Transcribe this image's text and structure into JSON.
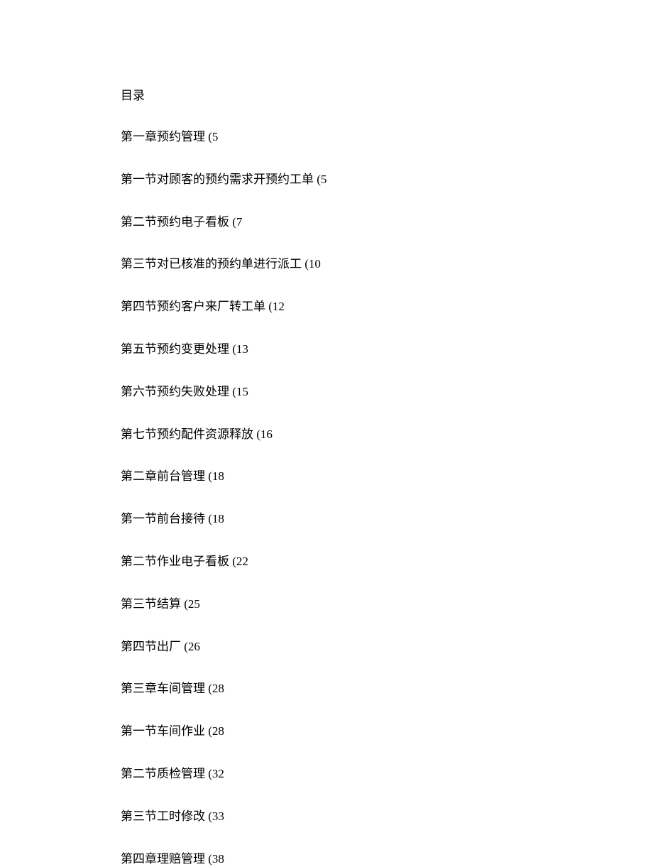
{
  "title": "目录",
  "entries": [
    {
      "label": "第一章预约管理",
      "page": "5"
    },
    {
      "label": "第一节对顾客的预约需求开预约工单",
      "page": "5"
    },
    {
      "label": "第二节预约电子看板",
      "page": "7"
    },
    {
      "label": "第三节对已核准的预约单进行派工",
      "page": "10"
    },
    {
      "label": "第四节预约客户来厂转工单",
      "page": "12"
    },
    {
      "label": "第五节预约变更处理",
      "page": "13"
    },
    {
      "label": "第六节预约失败处理",
      "page": "15"
    },
    {
      "label": "第七节预约配件资源释放",
      "page": "16"
    },
    {
      "label": "第二章前台管理",
      "page": "18"
    },
    {
      "label": "第一节前台接待",
      "page": "18"
    },
    {
      "label": "第二节作业电子看板",
      "page": "22"
    },
    {
      "label": "第三节结算",
      "page": "25"
    },
    {
      "label": "第四节出厂",
      "page": "26"
    },
    {
      "label": "第三章车间管理",
      "page": "28"
    },
    {
      "label": "第一节车间作业",
      "page": "28"
    },
    {
      "label": "第二节质检管理",
      "page": "32"
    },
    {
      "label": "第三节工时修改",
      "page": "33"
    },
    {
      "label": "第四章理赔管理",
      "page": "38"
    }
  ]
}
